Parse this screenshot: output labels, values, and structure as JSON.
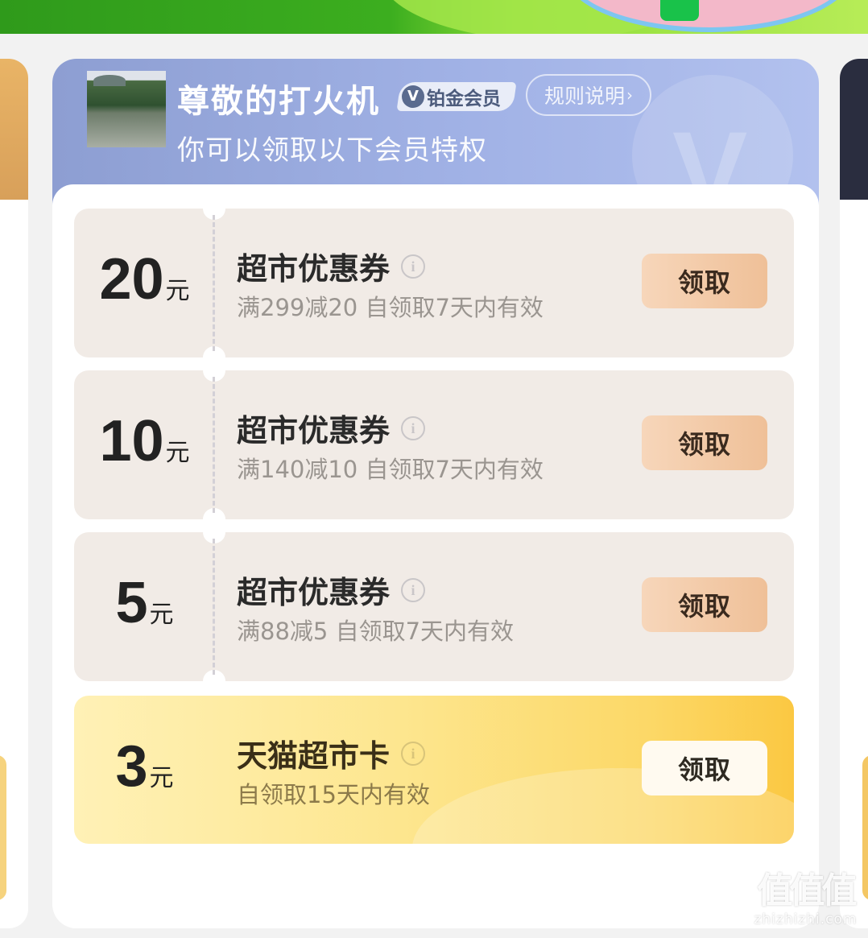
{
  "member_card": {
    "username": "尊敬的打火机",
    "tier_badge": "铂金会员",
    "tier_icon": "v-icon",
    "rules_link": "规则说明",
    "subtitle": "你可以领取以下会员特权"
  },
  "coupons": [
    {
      "amount": "20",
      "unit": "元",
      "title": "超市优惠券",
      "desc": "满299减20 自领取7天内有效",
      "button": "领取"
    },
    {
      "amount": "10",
      "unit": "元",
      "title": "超市优惠券",
      "desc": "满140减10 自领取7天内有效",
      "button": "领取"
    },
    {
      "amount": "5",
      "unit": "元",
      "title": "超市优惠券",
      "desc": "满88减5 自领取7天内有效",
      "button": "领取"
    },
    {
      "amount": "3",
      "unit": "元",
      "title": "天猫超市卡",
      "desc": "自领取15天内有效",
      "button": "领取"
    }
  ],
  "watermark": {
    "logo": "值值值",
    "domain": "zhizhizhi.com"
  },
  "colors": {
    "coupon_bg": "#f1ebe6",
    "claim_button": "#f2c9a4",
    "gold_card": "#fcd867",
    "header_gradient": "#9aabe0"
  }
}
